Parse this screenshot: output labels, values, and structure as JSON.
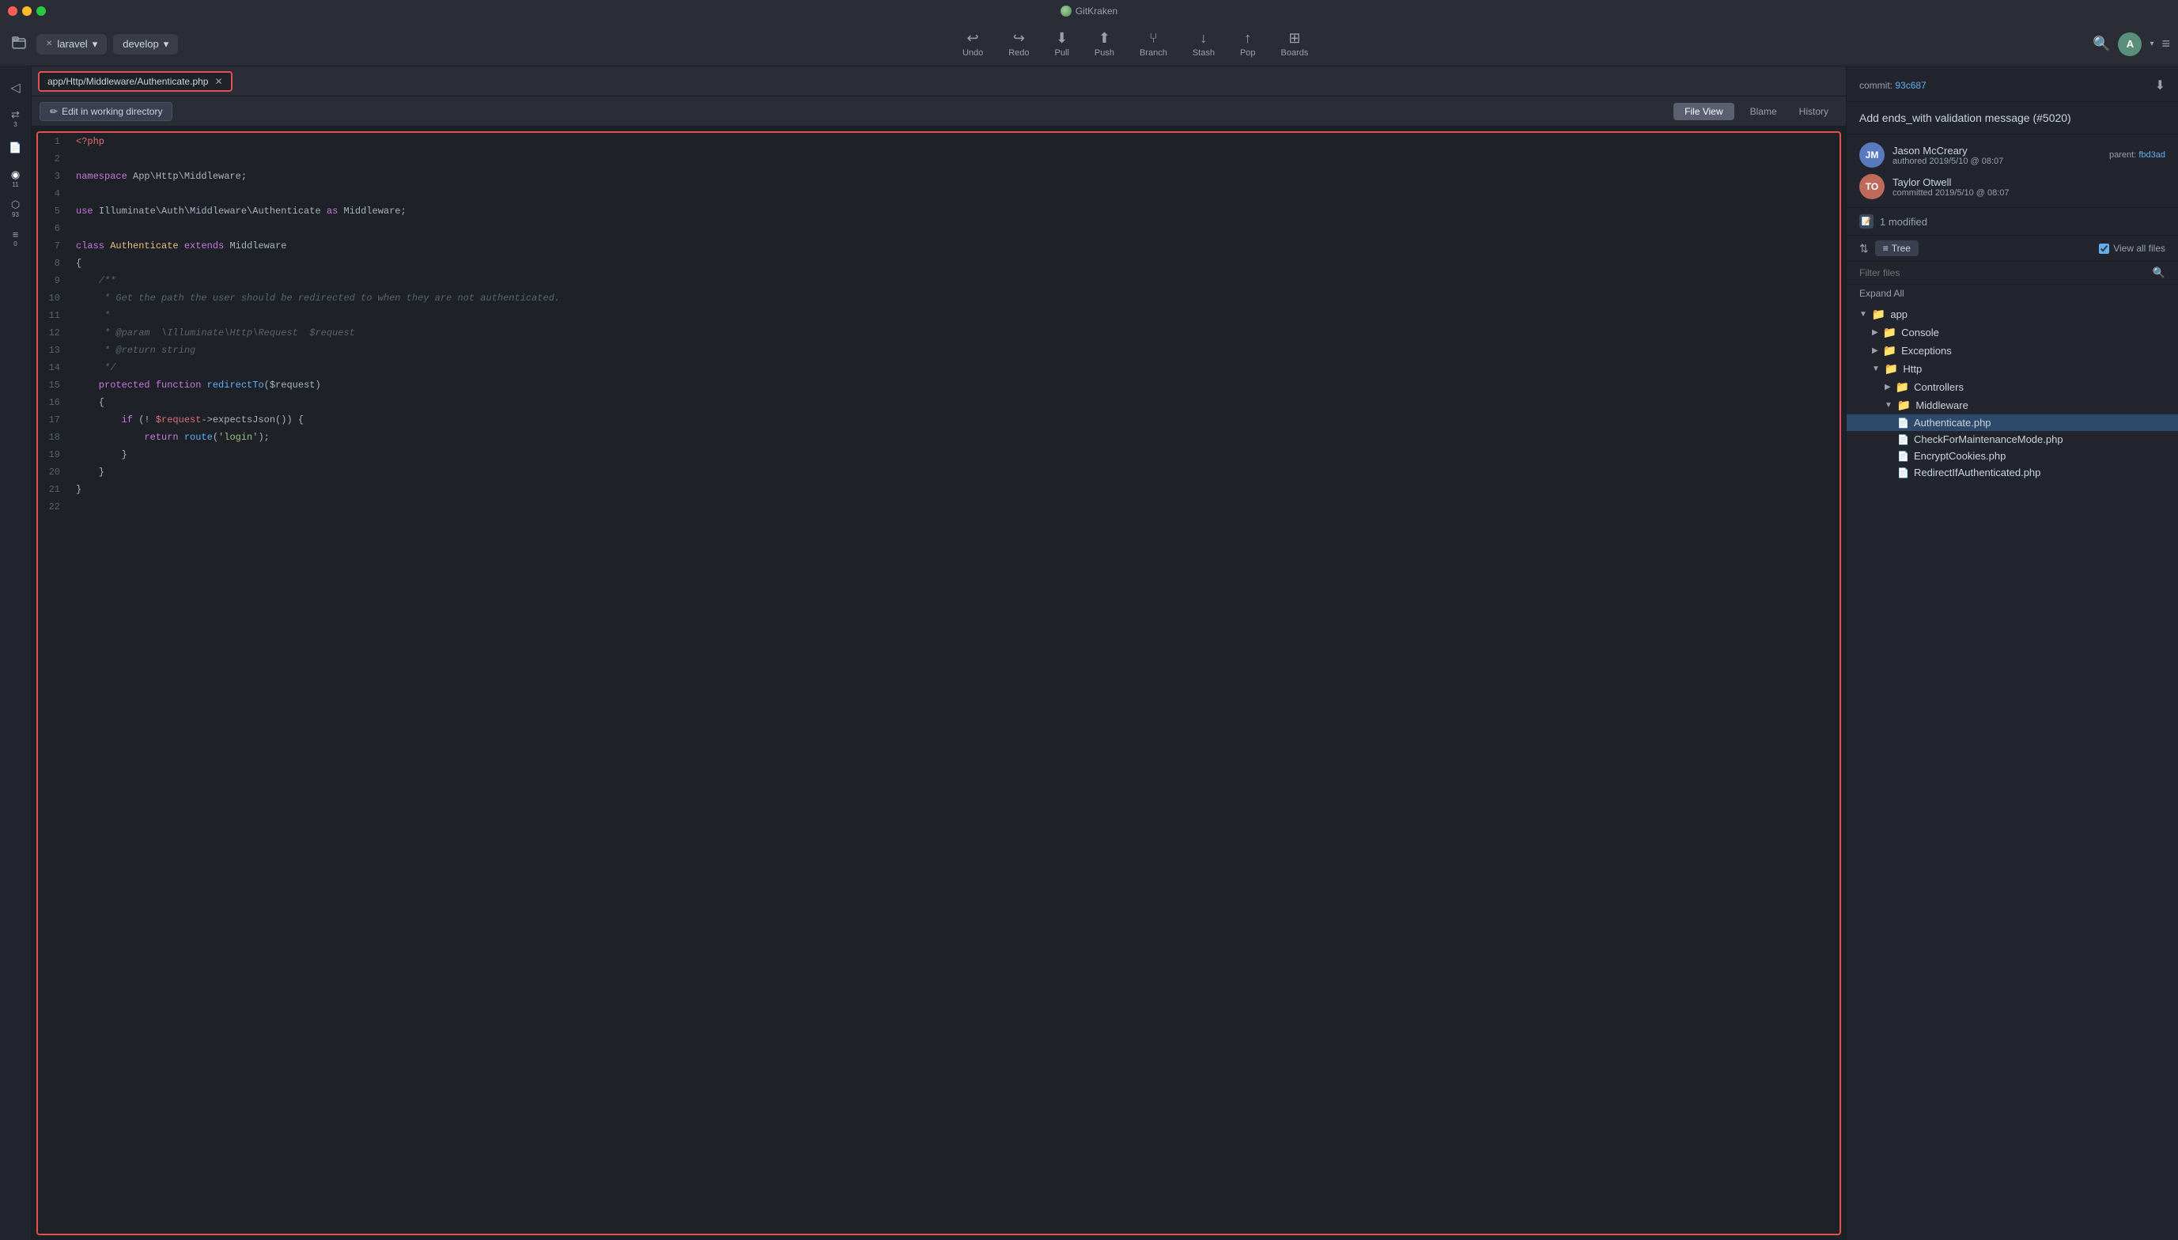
{
  "app": {
    "title": "GitKraken"
  },
  "titlebar": {
    "title": "GitKraken"
  },
  "toolbar": {
    "repo_name": "laravel",
    "branch_name": "develop",
    "undo_label": "Undo",
    "redo_label": "Redo",
    "pull_label": "Pull",
    "push_label": "Push",
    "branch_label": "Branch",
    "stash_label": "Stash",
    "pop_label": "Pop",
    "boards_label": "Boards",
    "avatar_initial": "A"
  },
  "file_tab": {
    "path": "app/Http/Middleware/Authenticate.php"
  },
  "file_controls": {
    "edit_label": "Edit in working directory",
    "file_view_label": "File View",
    "blame_label": "Blame",
    "history_label": "History"
  },
  "code": {
    "lines": [
      {
        "num": 1,
        "content": "<?php",
        "type": "php-tag"
      },
      {
        "num": 2,
        "content": "",
        "type": "blank"
      },
      {
        "num": 3,
        "content": "namespace App\\Http\\Middleware;",
        "type": "namespace"
      },
      {
        "num": 4,
        "content": "",
        "type": "blank"
      },
      {
        "num": 5,
        "content": "use Illuminate\\Auth\\Middleware\\Authenticate as Middleware;",
        "type": "use"
      },
      {
        "num": 6,
        "content": "",
        "type": "blank"
      },
      {
        "num": 7,
        "content": "class Authenticate extends Middleware",
        "type": "class"
      },
      {
        "num": 8,
        "content": "{",
        "type": "plain"
      },
      {
        "num": 9,
        "content": "    /**",
        "type": "comment"
      },
      {
        "num": 10,
        "content": "     * Get the path the user should be redirected to when they are not authenticated.",
        "type": "comment"
      },
      {
        "num": 11,
        "content": "     *",
        "type": "comment"
      },
      {
        "num": 12,
        "content": "     * @param  \\Illuminate\\Http\\Request  $request",
        "type": "comment"
      },
      {
        "num": 13,
        "content": "     * @return string",
        "type": "comment"
      },
      {
        "num": 14,
        "content": "     */",
        "type": "comment"
      },
      {
        "num": 15,
        "content": "    protected function redirectTo($request)",
        "type": "function"
      },
      {
        "num": 16,
        "content": "    {",
        "type": "plain"
      },
      {
        "num": 17,
        "content": "        if (! $request->expectsJson()) {",
        "type": "if"
      },
      {
        "num": 18,
        "content": "            return route('login');",
        "type": "return"
      },
      {
        "num": 19,
        "content": "        }",
        "type": "plain"
      },
      {
        "num": 20,
        "content": "    }",
        "type": "plain"
      },
      {
        "num": 21,
        "content": "}",
        "type": "plain"
      },
      {
        "num": 22,
        "content": "",
        "type": "blank"
      }
    ]
  },
  "right_panel": {
    "commit_label": "commit:",
    "commit_hash": "93c687",
    "parent_label": "parent:",
    "parent_hash": "fbd3ad",
    "commit_message": "Add ends_with validation message (#5020)",
    "author": {
      "name": "Jason McCreary",
      "role": "authored",
      "date": "2019/5/10 @ 08:07",
      "initials": "JM"
    },
    "committer": {
      "name": "Taylor Otwell",
      "role": "committed",
      "date": "2019/5/10 @ 08:07",
      "initials": "TO"
    },
    "modified_count": "1 modified",
    "tree_label": "Tree",
    "view_all_label": "View all files",
    "filter_placeholder": "Filter files",
    "expand_all_label": "Expand All",
    "file_tree": {
      "root": "app",
      "folders": [
        {
          "name": "Console",
          "indent": "indent-1",
          "open": false
        },
        {
          "name": "Exceptions",
          "indent": "indent-1",
          "open": false
        },
        {
          "name": "Http",
          "indent": "indent-1",
          "open": true,
          "subfolders": [
            {
              "name": "Controllers",
              "indent": "indent-2",
              "open": false
            },
            {
              "name": "Middleware",
              "indent": "indent-2",
              "open": true,
              "files": [
                {
                  "name": "Authenticate.php",
                  "indent": "indent-3",
                  "active": true
                },
                {
                  "name": "CheckForMaintenanceMode.php",
                  "indent": "indent-3",
                  "active": false
                },
                {
                  "name": "EncryptCookies.php",
                  "indent": "indent-3",
                  "active": false
                },
                {
                  "name": "RedirectIfAuthenticated.php",
                  "indent": "indent-3",
                  "active": false
                }
              ]
            }
          ]
        }
      ]
    }
  },
  "sidebar": {
    "items": [
      {
        "icon": "⟲",
        "label": "back",
        "badge": ""
      },
      {
        "icon": "⇄",
        "label": "diff",
        "badge": "3"
      },
      {
        "icon": "☰",
        "label": "menu",
        "badge": ""
      },
      {
        "icon": "◉",
        "label": "graph",
        "badge": "11"
      },
      {
        "icon": "⬡",
        "label": "hex",
        "badge": "93"
      },
      {
        "icon": "≡",
        "label": "layers",
        "badge": "0"
      }
    ]
  }
}
